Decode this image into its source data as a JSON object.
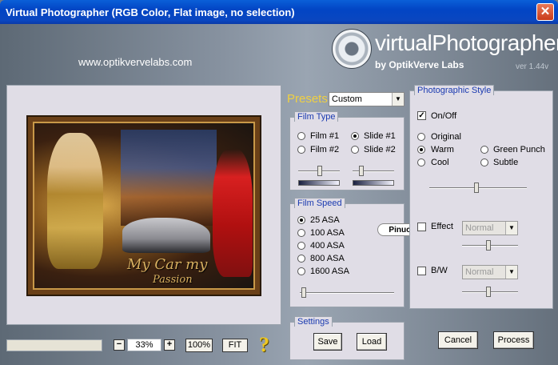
{
  "window": {
    "title": "Virtual Photographer (RGB Color, Flat image, no selection)",
    "close_glyph": "✕"
  },
  "header": {
    "url": "www.optikvervelabs.com",
    "logo_text": "virtualPhotographer",
    "logo_sub": "by OptikVerve Labs",
    "version": "ver 1.44v"
  },
  "preview": {
    "caption_line1": "My Car my",
    "caption_line2": "Passion"
  },
  "zoom": {
    "minus": "−",
    "value": "33%",
    "plus": "+",
    "btn_100": "100%",
    "btn_fit": "FIT",
    "help": "?"
  },
  "presets": {
    "label": "Presets",
    "selected": "Custom"
  },
  "film_type": {
    "title": "Film Type",
    "options": [
      {
        "label": "Film #1",
        "selected": false
      },
      {
        "label": "Slide #1",
        "selected": true
      },
      {
        "label": "Film #2",
        "selected": false
      },
      {
        "label": "Slide #2",
        "selected": false
      }
    ]
  },
  "film_speed": {
    "title": "Film Speed",
    "options": [
      {
        "label": "25 ASA",
        "selected": true
      },
      {
        "label": "100 ASA",
        "selected": false
      },
      {
        "label": "400 ASA",
        "selected": false
      },
      {
        "label": "800 ASA",
        "selected": false
      },
      {
        "label": "1600 ASA",
        "selected": false
      }
    ]
  },
  "stamp": "Pinuccia",
  "settings": {
    "title": "Settings",
    "save": "Save",
    "load": "Load"
  },
  "photo_style": {
    "title": "Photographic Style",
    "onoff": "On/Off",
    "onoff_checked": true,
    "styles": [
      {
        "label": "Original",
        "selected": false
      },
      {
        "label": "Warm",
        "selected": true
      },
      {
        "label": "Green Punch",
        "selected": false
      },
      {
        "label": "Cool",
        "selected": false
      },
      {
        "label": "Subtle",
        "selected": false
      }
    ],
    "effect_label": "Effect",
    "effect_mode": "Normal",
    "bw_label": "B/W",
    "bw_mode": "Normal"
  },
  "actions": {
    "cancel": "Cancel",
    "process": "Process"
  }
}
